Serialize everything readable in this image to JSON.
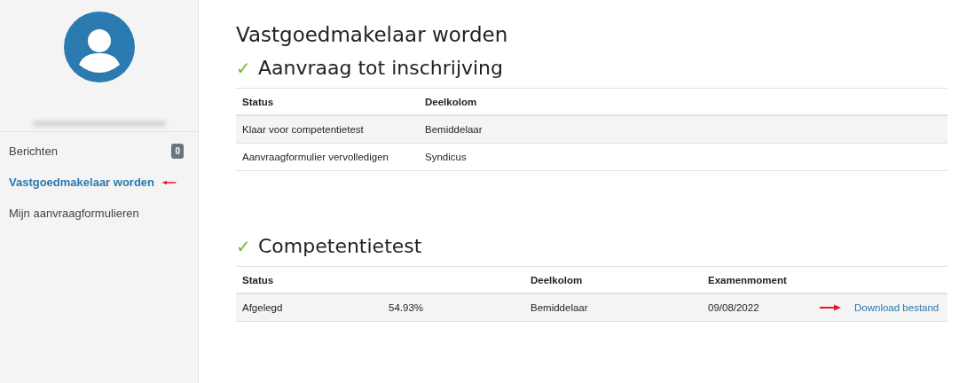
{
  "sidebar": {
    "items": [
      {
        "label": "Berichten",
        "selected": false,
        "badge": "0"
      },
      {
        "label": "Vastgoedmakelaar worden",
        "selected": true
      },
      {
        "label": "Mijn aanvraagformulieren",
        "selected": false
      }
    ]
  },
  "page": {
    "title": "Vastgoedmakelaar worden"
  },
  "sections": [
    {
      "check": "✓",
      "title": "Aanvraag tot inschrijving",
      "columns": [
        "Status",
        "Deelkolom"
      ],
      "rows": [
        {
          "cells": [
            "Klaar voor competentietest",
            "Bemiddelaar"
          ]
        },
        {
          "cells": [
            "Aanvraagformulier vervolledigen",
            "Syndicus"
          ]
        }
      ]
    },
    {
      "check": "✓",
      "title": "Competentietest",
      "columns": [
        "Status",
        "",
        "Deelkolom",
        "Examenmoment"
      ],
      "rows": [
        {
          "cells": [
            "Afgelegd",
            "54.93%",
            "Bemiddelaar",
            "09/08/2022"
          ],
          "action": "Download bestand"
        }
      ]
    }
  ]
}
